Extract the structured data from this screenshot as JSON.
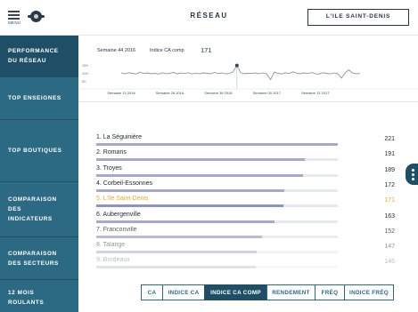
{
  "header": {
    "menu_label": "MENU",
    "title": "RÉSEAU",
    "store_selector": "L'ILE SAINT-DENIS"
  },
  "sidebar": {
    "items": [
      {
        "lines": [
          "PERFORMANCE",
          "DU RÉSEAU"
        ],
        "active": true
      },
      {
        "lines": [
          "TOP ENSEIGNES"
        ],
        "active": false
      },
      {
        "lines": [
          "TOP BOUTIQUES"
        ],
        "active": false
      },
      {
        "lines": [
          "COMPARAISON",
          "DES",
          "INDICATEURS"
        ],
        "active": false
      },
      {
        "lines": [
          "COMPARAISON",
          "DES SECTEURS"
        ],
        "active": false
      },
      {
        "lines": [
          "12 MOIS",
          "ROULANTS"
        ],
        "active": false
      }
    ]
  },
  "summary": {
    "week": "Semaine 44 2016",
    "index_label": "Indice CA comp",
    "index_value": "171"
  },
  "chart_data": {
    "type": "line",
    "title": "",
    "xlabel": "",
    "ylabel": "",
    "y_ticks": [
      "150",
      "100",
      "50"
    ],
    "ylim": [
      30,
      170
    ],
    "x_tick_labels": [
      "Semaine 13 2016",
      "Semaine 26 2016",
      "Semaine 39 2016",
      "Semaine 00 2017",
      "Semaine 13 2017"
    ],
    "x_tick_positions": [
      0,
      13,
      26,
      39,
      52
    ],
    "highlight_index": 31,
    "series": [
      {
        "values": [
          102,
          98,
          104,
          100,
          96,
          108,
          99,
          103,
          97,
          101,
          95,
          104,
          98,
          100,
          106,
          97,
          102,
          99,
          104,
          96,
          101,
          98,
          103,
          100,
          97,
          105,
          99,
          102,
          96,
          100,
          110,
          150,
          104,
          97,
          101,
          99,
          103,
          98,
          102,
          97,
          60,
          108,
          100,
          96,
          104,
          99,
          110,
          101,
          97,
          103,
          99,
          105,
          98,
          95,
          104,
          100,
          96,
          102,
          98,
          70,
          104,
          122,
          101,
          98,
          99
        ]
      }
    ],
    "color": "#8a93a6",
    "highlight_color": "#3a4654"
  },
  "ranking": {
    "max": 221,
    "items": [
      {
        "label": "1. La Séguinière",
        "value": 221,
        "highlight": false,
        "faded": 0
      },
      {
        "label": "2. Romans",
        "value": 191,
        "highlight": false,
        "faded": 0
      },
      {
        "label": "3. Troyes",
        "value": 189,
        "highlight": false,
        "faded": 0
      },
      {
        "label": "4. Corbeil-Essonnes",
        "value": 172,
        "highlight": false,
        "faded": 0
      },
      {
        "label": "5. L'Ile Saint-Denis",
        "value": 171,
        "highlight": true,
        "faded": 0
      },
      {
        "label": "6. Aubergenville",
        "value": 163,
        "highlight": false,
        "faded": 0
      },
      {
        "label": "7. Franconville",
        "value": 152,
        "highlight": false,
        "faded": 1
      },
      {
        "label": "8. Talange",
        "value": 147,
        "highlight": false,
        "faded": 2
      },
      {
        "label": "9. Bordeaux",
        "value": 146,
        "highlight": false,
        "faded": 3
      }
    ],
    "colors": {
      "bar": "#a7a8cf",
      "highlight": "#f5a623"
    }
  },
  "tabs": [
    {
      "label": "CA",
      "active": false
    },
    {
      "label": "INDICE CA",
      "active": false
    },
    {
      "label": "INDICE CA COMP",
      "active": true
    },
    {
      "label": "RENDEMENT",
      "active": false
    },
    {
      "label": "FRÉQ",
      "active": false
    },
    {
      "label": "INDICE FRÉQ",
      "active": false
    }
  ]
}
